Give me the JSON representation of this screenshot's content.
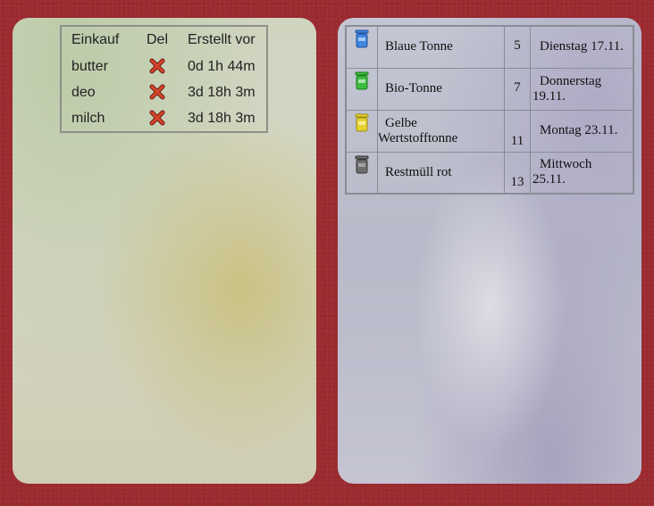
{
  "shopping": {
    "headers": [
      "Einkauf",
      "Del",
      "Erstellt vor"
    ],
    "items": [
      {
        "name": "butter",
        "age": "0d 1h 44m"
      },
      {
        "name": "deo",
        "age": "3d 18h 3m"
      },
      {
        "name": "milch",
        "age": "3d 18h 3m"
      }
    ]
  },
  "trash": {
    "rows": [
      {
        "icon": "blue-bin-icon",
        "color": "#3e86e0",
        "name": "Blaue Tonne",
        "days": "5",
        "date": "Dienstag 17.11."
      },
      {
        "icon": "green-bin-icon",
        "color": "#3cba3c",
        "name": "Bio-Tonne",
        "days": "7",
        "date_line1": "Donnerstag",
        "date_line2": "19.11."
      },
      {
        "icon": "yellow-bin-icon",
        "color": "#e6d230",
        "name_line1": "Gelbe",
        "name_line2": "Wertstofftonne",
        "days": "11",
        "date": "Montag 23.11."
      },
      {
        "icon": "grey-bin-icon",
        "color": "#6d6d6d",
        "name": "Restmüll rot",
        "days": "13",
        "date_line1": "Mittwoch",
        "date_line2": "25.11."
      }
    ]
  },
  "colors": {
    "background": "#9c2a30",
    "delete": "#d9452a"
  }
}
